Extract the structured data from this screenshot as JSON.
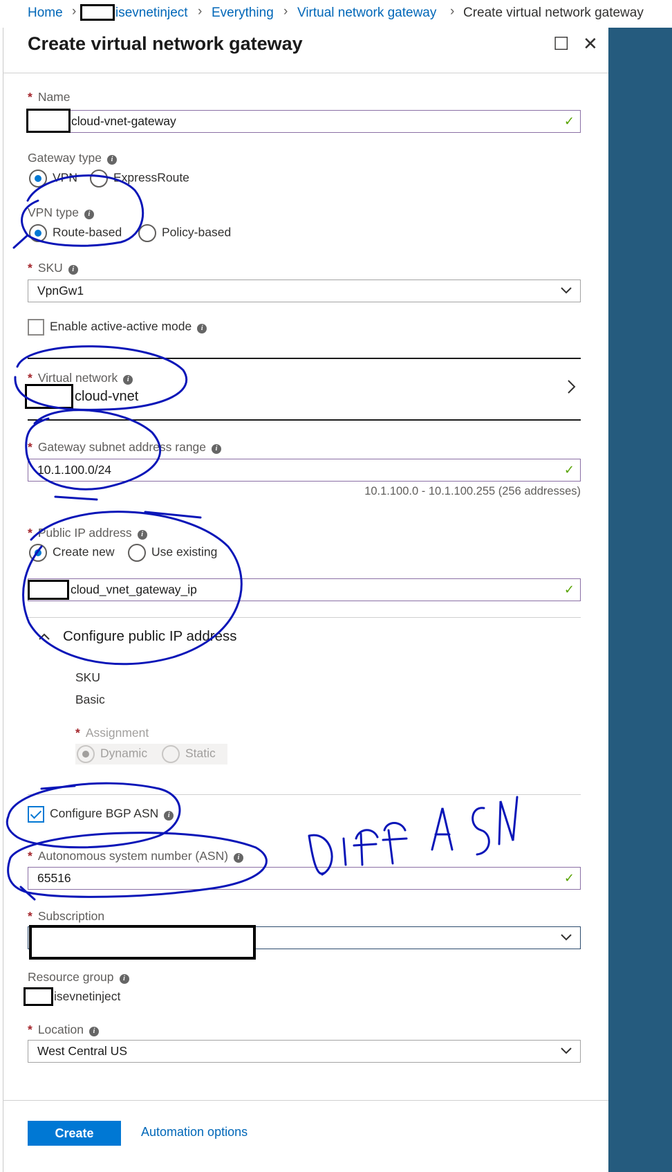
{
  "breadcrumb": {
    "home": "Home",
    "resource_group": "isevnetinject",
    "everything": "Everything",
    "vng": "Virtual network gateway",
    "current": "Create virtual network gateway"
  },
  "blade": {
    "title": "Create virtual network gateway",
    "maximize_icon": "☐",
    "close_icon": "✕"
  },
  "form": {
    "name": {
      "label": "Name",
      "value": "cloud-vnet-gateway"
    },
    "gateway_type": {
      "label": "Gateway type",
      "options": [
        "VPN",
        "ExpressRoute"
      ],
      "selected": "VPN"
    },
    "vpn_type": {
      "label": "VPN type",
      "options": [
        "Route-based",
        "Policy-based"
      ],
      "selected": "Route-based"
    },
    "sku": {
      "label": "SKU",
      "value": "VpnGw1"
    },
    "active_active": {
      "label": "Enable active-active mode",
      "checked": false
    },
    "virtual_network": {
      "label": "Virtual network",
      "value": "cloud-vnet"
    },
    "gateway_subnet": {
      "label": "Gateway subnet address range",
      "value": "10.1.100.0/24",
      "hint": "10.1.100.0 - 10.1.100.255 (256 addresses)"
    },
    "public_ip": {
      "label": "Public IP address",
      "options": [
        "Create new",
        "Use existing"
      ],
      "selected": "Create new",
      "value": "cloud_vnet_gateway_ip"
    },
    "configure_public_ip": {
      "title": "Configure public IP address",
      "sku_label": "SKU",
      "sku_value": "Basic",
      "assignment_label": "Assignment",
      "assignment_options": [
        "Dynamic",
        "Static"
      ],
      "assignment_selected": "Dynamic"
    },
    "bgp": {
      "label": "Configure BGP ASN",
      "checked": true
    },
    "asn": {
      "label": "Autonomous system number (ASN)",
      "value": "65516"
    },
    "subscription": {
      "label": "Subscription",
      "value": ""
    },
    "resource_group": {
      "label": "Resource group",
      "value": "isevnetinject"
    },
    "location": {
      "label": "Location",
      "value": "West Central US"
    }
  },
  "actions": {
    "create": "Create",
    "automation": "Automation options"
  },
  "annotation": {
    "handwritten_text": "Diff ASN",
    "ink_color": "#0a16b8"
  },
  "colors": {
    "accent": "#0078d4",
    "link": "#0067b8",
    "required": "#a4262c",
    "valid": "#57a300",
    "sidebar": "#255b7e"
  }
}
